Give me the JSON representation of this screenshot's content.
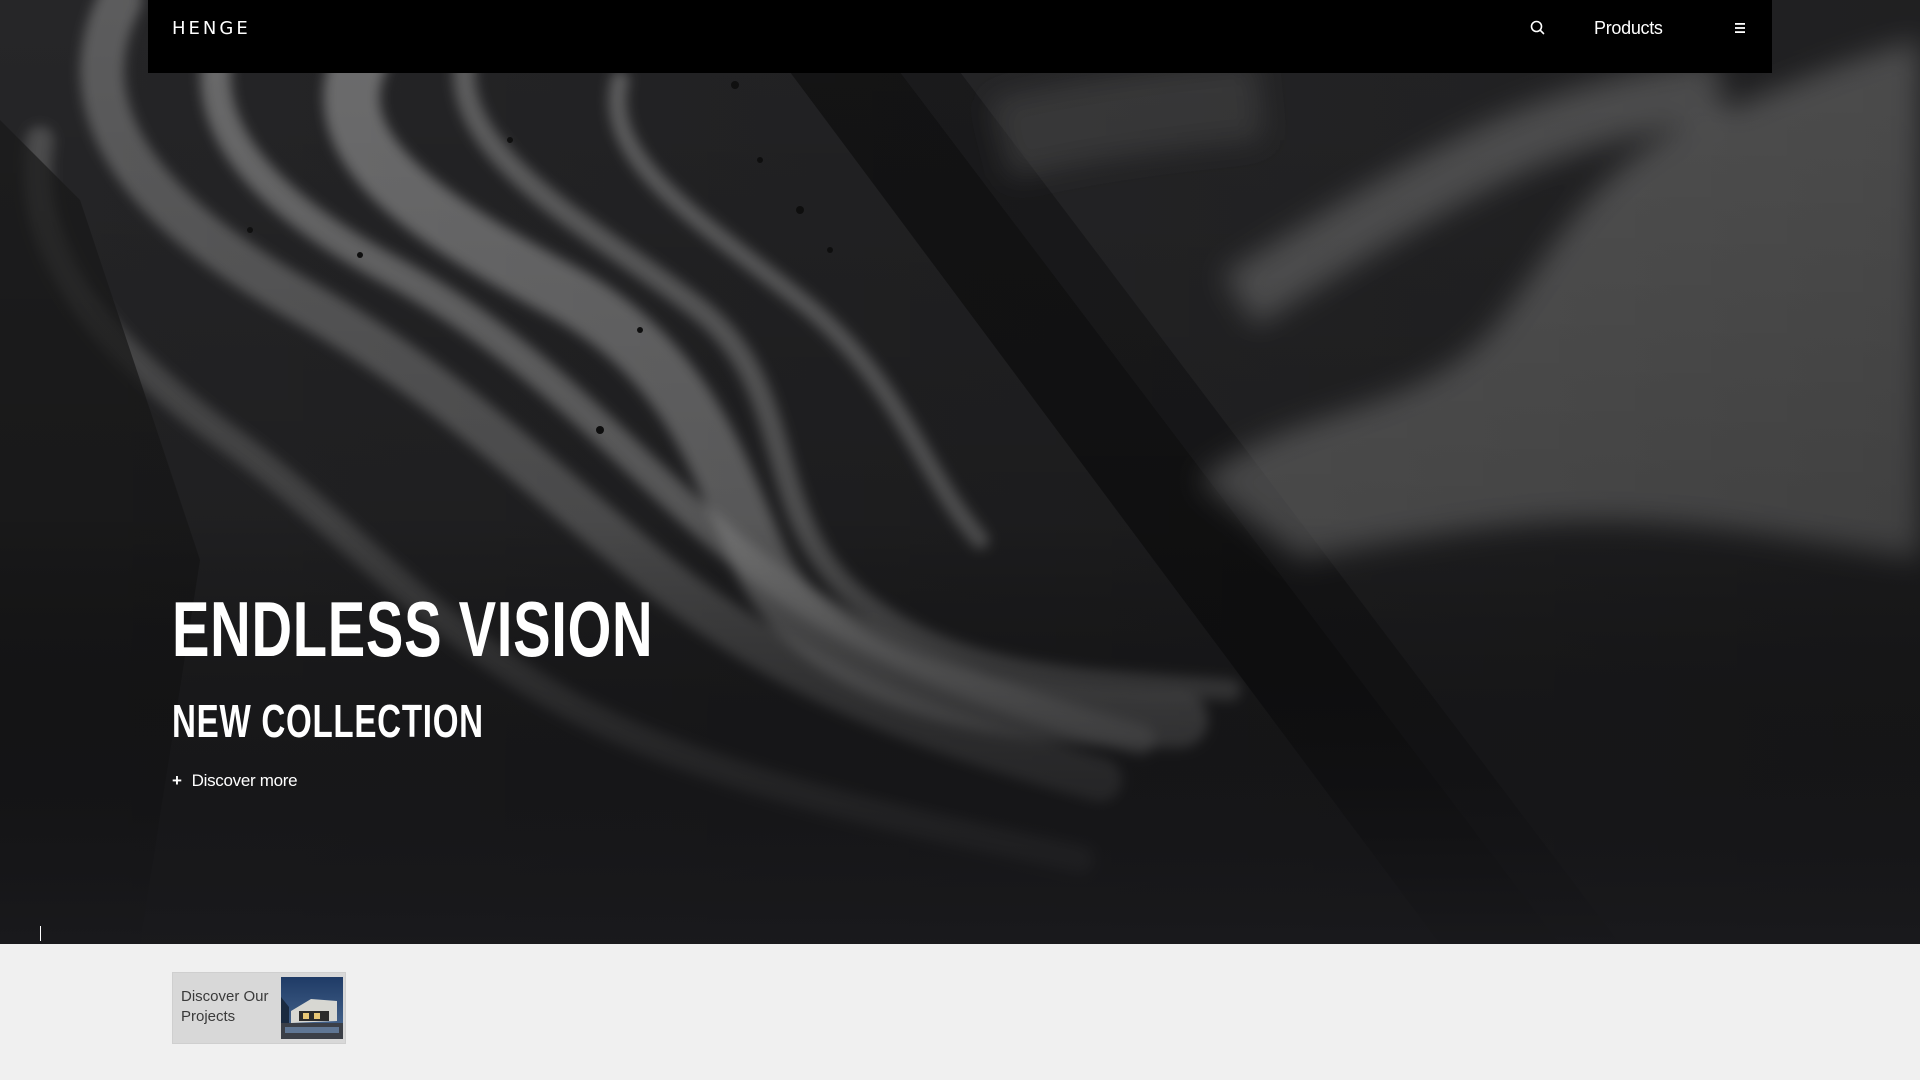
{
  "header": {
    "logo": "HENGE",
    "products_label": "Products",
    "search_icon": "search-icon",
    "menu_icon": "hamburger-menu-icon"
  },
  "hero": {
    "title": "ENDLESS VISION",
    "subtitle": "NEW COLLECTION",
    "cta_icon": "+",
    "cta_label": "Discover more"
  },
  "projects_card": {
    "label": "Discover Our Projects"
  },
  "colors": {
    "header_bg": "#000000",
    "hero_bg": "#1c1c1e",
    "footer_bg": "#f0f0f0",
    "card_bg": "#d8d8d8",
    "text_light": "#ffffff"
  }
}
